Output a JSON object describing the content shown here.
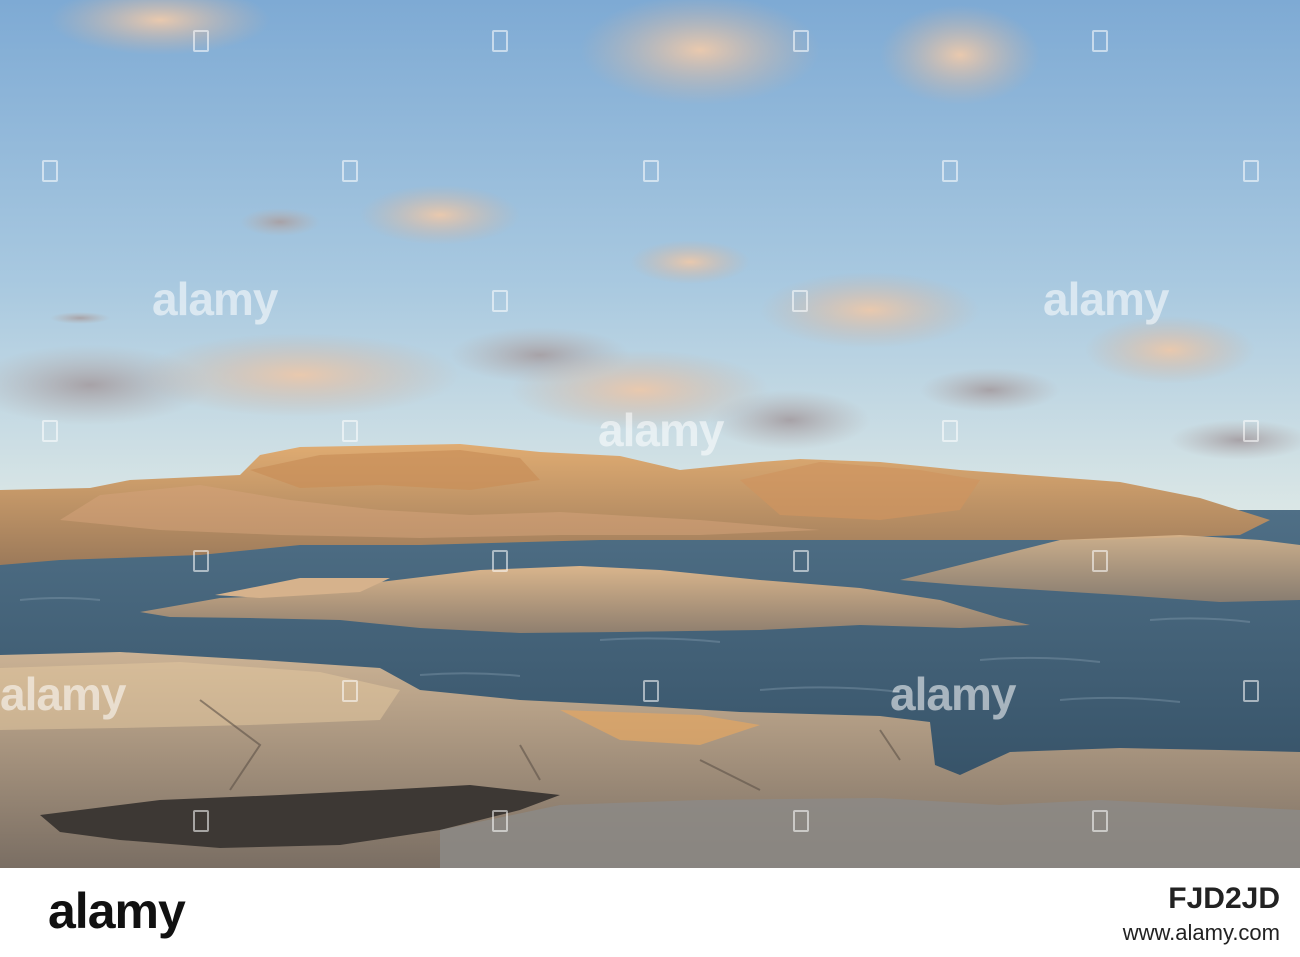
{
  "watermark": {
    "brand": "alamy"
  },
  "footer": {
    "logo": "alamy",
    "image_id": "FJD2JD",
    "site": "www.alamy.com"
  },
  "colors": {
    "sky_top": "#8fb6d9",
    "sky_horizon": "#d9e6ea",
    "sea": "#3c5a72",
    "rock_lit": "#d8a46c",
    "rock_shadow": "#8a6f55"
  }
}
